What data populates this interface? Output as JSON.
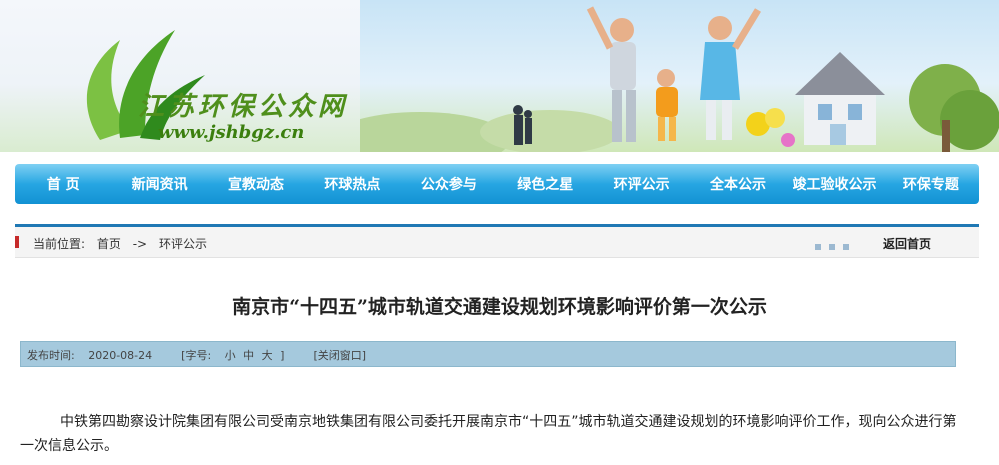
{
  "header": {
    "site_name": "江苏环保公众网",
    "site_url": "www.jshbgz.cn"
  },
  "nav": {
    "items": [
      "首 页",
      "新闻资讯",
      "宣教动态",
      "环球热点",
      "公众参与",
      "绿色之星",
      "环评公示",
      "全本公示",
      "竣工验收公示",
      "环保专题"
    ]
  },
  "breadcrumb": {
    "label": "当前位置:",
    "home": "首页",
    "separator": "->",
    "current": "环评公示",
    "back": "返回首页"
  },
  "article": {
    "title": "南京市“十四五”城市轨道交通建设规划环境影响评价第一次公示",
    "meta": {
      "date_label": "发布时间:",
      "date": "2020-08-24",
      "font_label": "[字号:",
      "size_small": "小",
      "size_medium": "中",
      "size_large": "大",
      "font_close": "]",
      "close_window": "[关闭窗口]"
    },
    "body": "中铁第四勘察设计院集团有限公司受南京地铁集团有限公司委托开展南京市“十四五”城市轨道交通建设规划的环境影响评价工作，现向公众进行第一次信息公示。"
  },
  "colors": {
    "nav_bg": "#1f9fdd",
    "logo_green": "#4f8f1c",
    "meta_bar": "#a5c9dd",
    "crumb_marker": "#c62b2b"
  }
}
